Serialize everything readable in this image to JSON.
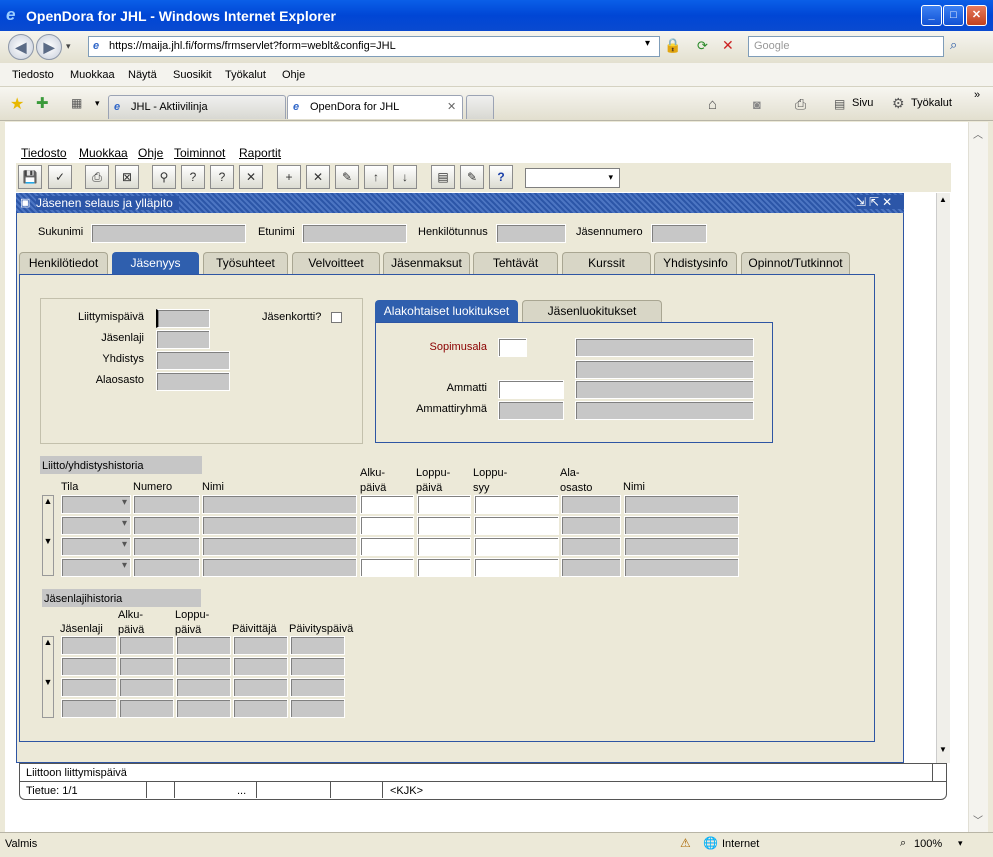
{
  "window": {
    "title": "OpenDora for JHL - Windows Internet Explorer"
  },
  "address": {
    "url": "https://maija.jhl.fi/forms/frmservlet?form=weblt&config=JHL",
    "search_placeholder": "Google"
  },
  "ie_menu": [
    "Tiedosto",
    "Muokkaa",
    "Näytä",
    "Suosikit",
    "Työkalut",
    "Ohje"
  ],
  "tabs": [
    "JHL - Aktiivilinja",
    "OpenDora for JHL"
  ],
  "ie_tools": {
    "page": "Sivu",
    "tools": "Työkalut"
  },
  "form_menu": [
    "Tiedosto",
    "Muokkaa",
    "Ohje",
    "Toiminnot",
    "Raportit"
  ],
  "form": {
    "title": "Jäsenen selaus ja ylläpito",
    "header_labels": {
      "sukunimi": "Sukunimi",
      "etunimi": "Etunimi",
      "henkilotunnus": "Henkilötunnus",
      "jasennumero": "Jäsennumero"
    },
    "tabs": [
      "Henkilötiedot",
      "Jäsenyys",
      "Työsuhteet",
      "Velvoitteet",
      "Jäsenmaksut",
      "Tehtävät",
      "Kurssit",
      "Yhdistysinfo",
      "Opinnot/Tutkinnot"
    ],
    "membership": {
      "liittymispaiva": "Liittymispäivä",
      "jasenlaji": "Jäsenlaji",
      "yhdistys": "Yhdistys",
      "alaosasto": "Alaosasto",
      "jasenkortti": "Jäsenkortti?"
    },
    "subtabs": [
      "Alakohtaiset luokitukset",
      "Jäsenluokitukset"
    ],
    "classifications": {
      "sopimusala": "Sopimusala",
      "ammatti": "Ammatti",
      "ammattiryhma": "Ammattiryhmä"
    },
    "history1": {
      "title": "Liitto/yhdistyshistoria",
      "cols": [
        "Tila",
        "Numero",
        "Nimi",
        "Alku-\npäivä",
        "Loppu-\npäivä",
        "Loppu-\nsyy",
        "Ala-\nosasto",
        "Nimi"
      ]
    },
    "history2": {
      "title": "Jäsenlajihistoria",
      "cols": [
        "Jäsenlaji",
        "Alku-\npäivä",
        "Loppu-\npäivä",
        "Päivittäjä",
        "Päivityspäivä"
      ]
    }
  },
  "bottom": {
    "hint": "Liittoon liittymispäivä",
    "record": "Tietue: 1/1",
    "dots": "...",
    "kjk": "<KJK>"
  },
  "status": {
    "left": "Valmis",
    "zone": "Internet",
    "zoom": "100%"
  },
  "colors": {
    "title_blue": "#0a5fe8",
    "form_blue": "#2e55a3",
    "required_label": "#8b0000"
  }
}
